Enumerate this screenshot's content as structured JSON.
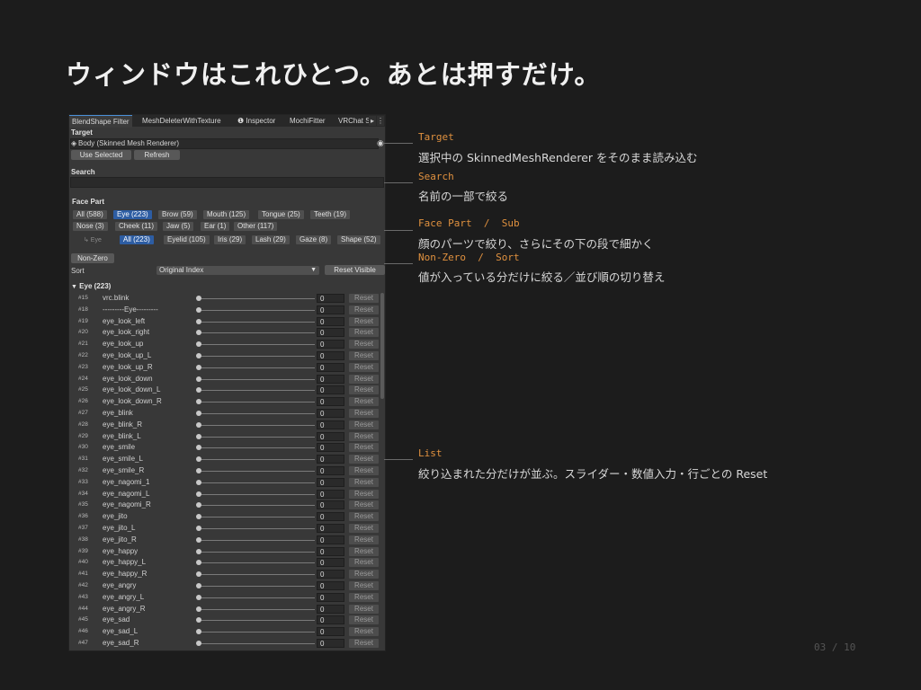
{
  "headline": "ウィンドウはこれひとつ。あとは押すだけ。",
  "panel": {
    "tabs": [
      "BlendShape Filter",
      "MeshDeleterWithTexture",
      "Inspector",
      "MochiFitter",
      "VRChat S"
    ],
    "target_label": "Target",
    "target_value": "Body (Skinned Mesh Renderer)",
    "use_selected": "Use Selected",
    "refresh": "Refresh",
    "search_label": "Search",
    "face_part_label": "Face Part",
    "face_parts": [
      "All (588)",
      "Eye (223)",
      "Brow (59)",
      "Mouth (125)",
      "Tongue (25)",
      "Teeth (19)",
      "Nose (3)",
      "Cheek (11)",
      "Jaw (5)",
      "Ear (1)",
      "Other (117)"
    ],
    "sub_prefix": "↳ Eye",
    "sub_parts": [
      "All (223)",
      "Eyelid (105)",
      "Iris (29)",
      "Lash (29)",
      "Gaze (8)",
      "Shape (52)"
    ],
    "non_zero": "Non-Zero",
    "sort_label": "Sort",
    "sort_value": "Original Index",
    "reset_visible": "Reset Visible",
    "group_title": "Eye  (223)",
    "reset_label": "Reset",
    "rows": [
      {
        "idx": "#15",
        "name": "vrc.blink",
        "value": "0"
      },
      {
        "idx": "#18",
        "name": "---------Eye---------",
        "value": "0"
      },
      {
        "idx": "#19",
        "name": "eye_look_left",
        "value": "0"
      },
      {
        "idx": "#20",
        "name": "eye_look_right",
        "value": "0"
      },
      {
        "idx": "#21",
        "name": "eye_look_up",
        "value": "0"
      },
      {
        "idx": "#22",
        "name": "eye_look_up_L",
        "value": "0"
      },
      {
        "idx": "#23",
        "name": "eye_look_up_R",
        "value": "0"
      },
      {
        "idx": "#24",
        "name": "eye_look_down",
        "value": "0"
      },
      {
        "idx": "#25",
        "name": "eye_look_down_L",
        "value": "0"
      },
      {
        "idx": "#26",
        "name": "eye_look_down_R",
        "value": "0"
      },
      {
        "idx": "#27",
        "name": "eye_blink",
        "value": "0"
      },
      {
        "idx": "#28",
        "name": "eye_blink_R",
        "value": "0"
      },
      {
        "idx": "#29",
        "name": "eye_blink_L",
        "value": "0"
      },
      {
        "idx": "#30",
        "name": "eye_smile",
        "value": "0"
      },
      {
        "idx": "#31",
        "name": "eye_smile_L",
        "value": "0"
      },
      {
        "idx": "#32",
        "name": "eye_smile_R",
        "value": "0"
      },
      {
        "idx": "#33",
        "name": "eye_nagomi_1",
        "value": "0"
      },
      {
        "idx": "#34",
        "name": "eye_nagomi_L",
        "value": "0"
      },
      {
        "idx": "#35",
        "name": "eye_nagomi_R",
        "value": "0"
      },
      {
        "idx": "#36",
        "name": "eye_jito",
        "value": "0"
      },
      {
        "idx": "#37",
        "name": "eye_jito_L",
        "value": "0"
      },
      {
        "idx": "#38",
        "name": "eye_jito_R",
        "value": "0"
      },
      {
        "idx": "#39",
        "name": "eye_happy",
        "value": "0"
      },
      {
        "idx": "#40",
        "name": "eye_happy_L",
        "value": "0"
      },
      {
        "idx": "#41",
        "name": "eye_happy_R",
        "value": "0"
      },
      {
        "idx": "#42",
        "name": "eye_angry",
        "value": "0"
      },
      {
        "idx": "#43",
        "name": "eye_angry_L",
        "value": "0"
      },
      {
        "idx": "#44",
        "name": "eye_angry_R",
        "value": "0"
      },
      {
        "idx": "#45",
        "name": "eye_sad",
        "value": "0"
      },
      {
        "idx": "#46",
        "name": "eye_sad_L",
        "value": "0"
      },
      {
        "idx": "#47",
        "name": "eye_sad_R",
        "value": "0"
      }
    ]
  },
  "annotations": [
    {
      "heading": "Target",
      "text": "選択中の SkinnedMeshRenderer をそのまま読み込む"
    },
    {
      "heading": "Search",
      "text": "名前の一部で絞る"
    },
    {
      "heading": "Face Part  /  Sub",
      "text": "顔のパーツで絞り、さらにその下の段で細かく"
    },
    {
      "heading": "Non-Zero  /  Sort",
      "text": "値が入っている分だけに絞る／並び順の切り替え"
    },
    {
      "heading": "List",
      "text": "絞り込まれた分だけが並ぶ。スライダー・数値入力・行ごとの Reset"
    }
  ],
  "page_number": "03 / 10",
  "colors": {
    "accent": "#e0913f",
    "selected_chip": "#2d5da3",
    "background": "#1c1c1c"
  }
}
